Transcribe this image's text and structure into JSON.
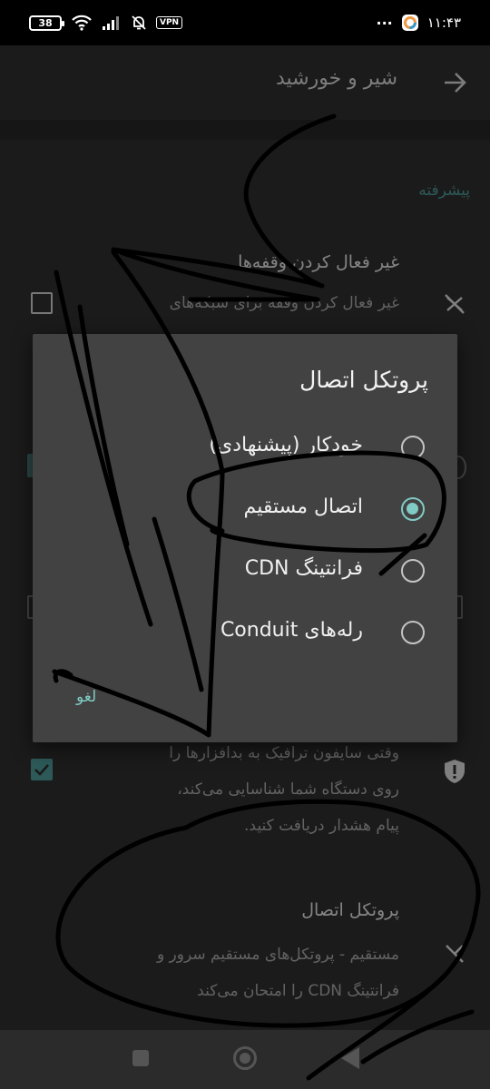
{
  "status_bar": {
    "battery": "38",
    "vpn": "VPN",
    "time": "۱۱:۴۳",
    "more": "···"
  },
  "toolbar": {
    "title": "شیر و خورشید"
  },
  "settings": {
    "section_header": "پیشرفته",
    "disable_timeouts": {
      "title": "غیر فعال کردن وقفه‌ها",
      "summary": "غیر فعال کردن وقفه برای شبکه‌های"
    },
    "ad_warning": {
      "summary_lines": [
        "وقتی سایفون ترافیک به بدافزارها را",
        "روی دستگاه شما شناسایی می‌کند،",
        "پیام هشدار دریافت کنید."
      ]
    },
    "connection_protocol": {
      "title": "پروتکل اتصال",
      "summary_lines": [
        "مستقیم - پروتکل‌های مستقیم سرور و",
        "فرانتینگ CDN را امتحان می‌کند"
      ]
    }
  },
  "dialog": {
    "title": "پروتکل اتصال",
    "options": [
      {
        "label": "خودکار (پیشنهادی)",
        "selected": false
      },
      {
        "label": "اتصال مستقیم",
        "selected": true
      },
      {
        "label": "فرانتینگ CDN",
        "selected": false
      },
      {
        "label": "رله‌های Conduit",
        "selected": false
      }
    ],
    "cancel_label": "لغو"
  },
  "colors": {
    "accent": "#80cbc4",
    "section_accent": "#4e9a99",
    "dialog_bg": "#424242",
    "screen_bg": "#303030"
  }
}
